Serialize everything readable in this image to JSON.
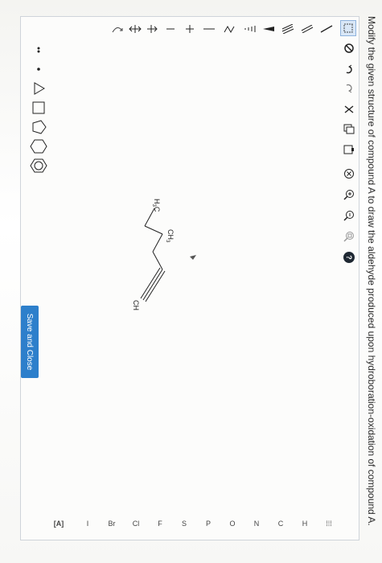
{
  "prompt": "Modify the given structure of compound A to draw the aldehyde produced upon hydroboration-oxidation of compound A.",
  "toolbar": {
    "icons": [
      "select-lasso-icon",
      "eraser-icon",
      "undo-icon",
      "redo-icon",
      "cut-icon",
      "copy-icon",
      "paste-icon",
      "clear-icon",
      "zoom-in-icon",
      "zoom-out-icon",
      "zoom-fit-icon",
      "help-icon"
    ],
    "help_label": "?"
  },
  "bonds": {
    "icons": [
      "single-bond-icon",
      "double-bond-icon",
      "triple-bond-icon",
      "wedge-bond-icon",
      "hash-bond-icon",
      "chain-icon",
      "charge-icon",
      "plus-icon",
      "minus-icon",
      "arrow-icon",
      "double-arrow-icon",
      "curved-arrow-icon"
    ]
  },
  "atoms": {
    "periodic_label": "⁞⁞⁞",
    "items": [
      "H",
      "C",
      "N",
      "O",
      "P",
      "S",
      "F",
      "Cl",
      "Br",
      "I"
    ],
    "more_label": "[A]"
  },
  "rings": {
    "icons": [
      "lone-pair-icon",
      "radical-icon",
      "cyclopropane-icon",
      "cyclobutane-icon",
      "cyclopentane-icon",
      "cyclohexane-icon",
      "benzene-icon"
    ]
  },
  "molecule": {
    "labels": {
      "methyl_top": "CH3",
      "methyl_left": "H3C",
      "alkyne_end": "CH"
    }
  },
  "save_button": "Save and Close"
}
